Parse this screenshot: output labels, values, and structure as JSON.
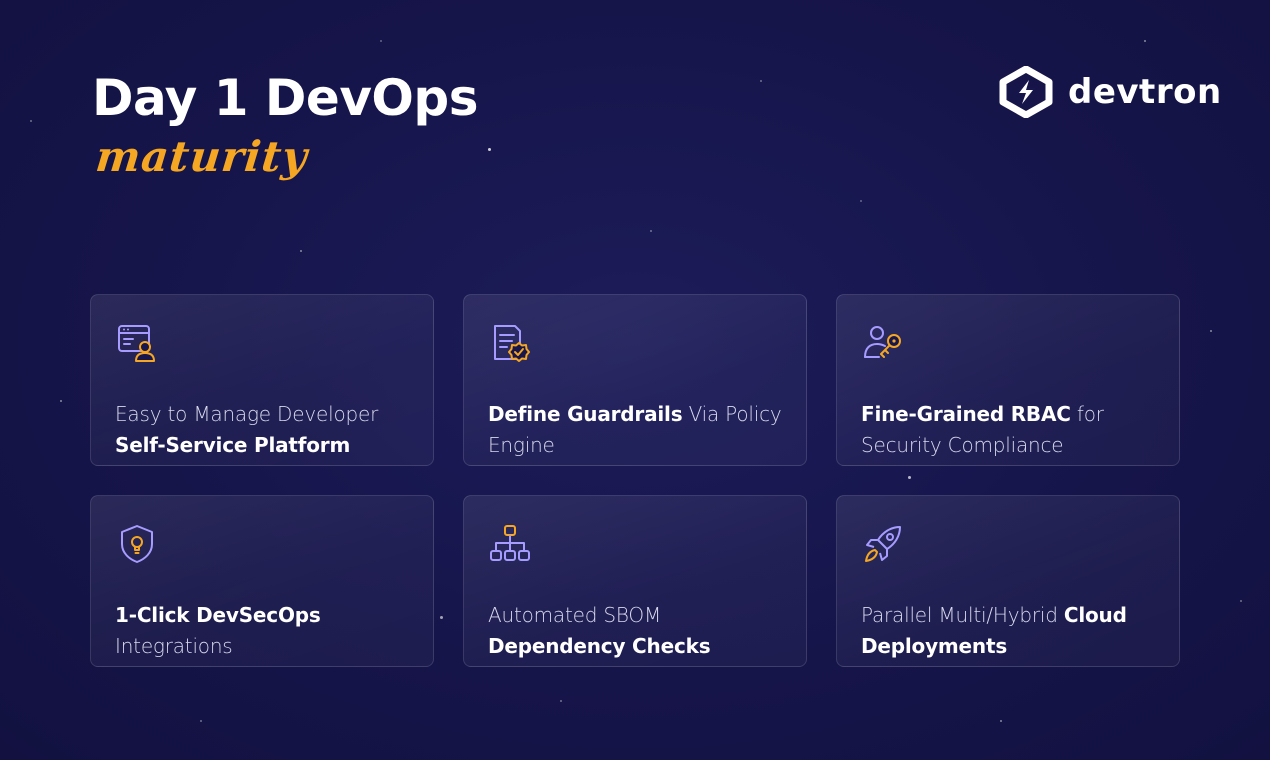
{
  "headline": {
    "title": "Day 1 DevOps",
    "subtitle": "maturity"
  },
  "brand": {
    "name": "devtron"
  },
  "colors": {
    "accent": "#f5a623",
    "icon_stroke": "#a69cff",
    "background": "#17164d"
  },
  "cards": [
    {
      "icon": "browser-user-icon",
      "t1": "Easy to Manage Developer ",
      "t2": "Self-Service Platform",
      "t3": ""
    },
    {
      "icon": "policy-document-icon",
      "t1": "",
      "t2": "Define Guardrails",
      "t3": " Via Policy Engine"
    },
    {
      "icon": "user-key-icon",
      "t1": "",
      "t2": "Fine-Grained RBAC",
      "t3": " for Security Compliance"
    },
    {
      "icon": "shield-icon",
      "t1": "",
      "t2": "1-Click DevSecOps",
      "t3": " Integrations"
    },
    {
      "icon": "hierarchy-icon",
      "t1": "Automated SBOM ",
      "t2": "Dependency Checks",
      "t3": ""
    },
    {
      "icon": "rocket-icon",
      "t1": "Parallel Multi/Hybrid ",
      "t2": "Cloud Deployments",
      "t3": ""
    }
  ]
}
